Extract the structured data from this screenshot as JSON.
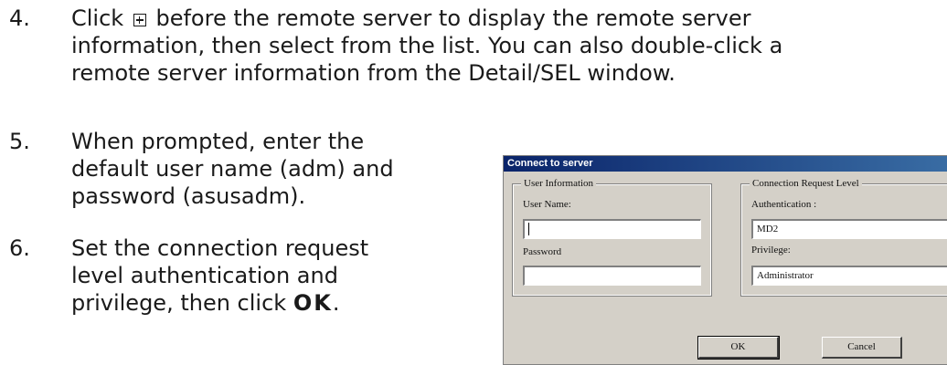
{
  "steps": [
    {
      "num": "4.",
      "lines": [
        {
          "pre": "Click",
          "post": "before the remote server to display the remote server"
        },
        {
          "text": "information, then select from the list. You can also double-click a"
        },
        {
          "text": "remote server information from the Detail/SEL window."
        }
      ]
    },
    {
      "num": "5.",
      "lines": [
        "When prompted, enter the",
        "default user name (adm) and",
        "password (asusadm)."
      ]
    },
    {
      "num": "6.",
      "lines": [
        "Set the connection request",
        "level authentication and"
      ],
      "last_pre": "privilege, then click",
      "last_bold": "OK",
      "last_post": "."
    }
  ],
  "dialog": {
    "title": "Connect to server",
    "user_group": {
      "title": "User Information",
      "user_name_label": "User Name:",
      "user_name_value": "",
      "password_label": "Password",
      "password_value": ""
    },
    "conn_group": {
      "title": "Connection Request Level",
      "auth_label": "Authentication :",
      "auth_value": "MD2",
      "priv_label": "Privilege:",
      "priv_value": "Administrator"
    },
    "ok_label": "OK",
    "cancel_label": "Cancel"
  }
}
